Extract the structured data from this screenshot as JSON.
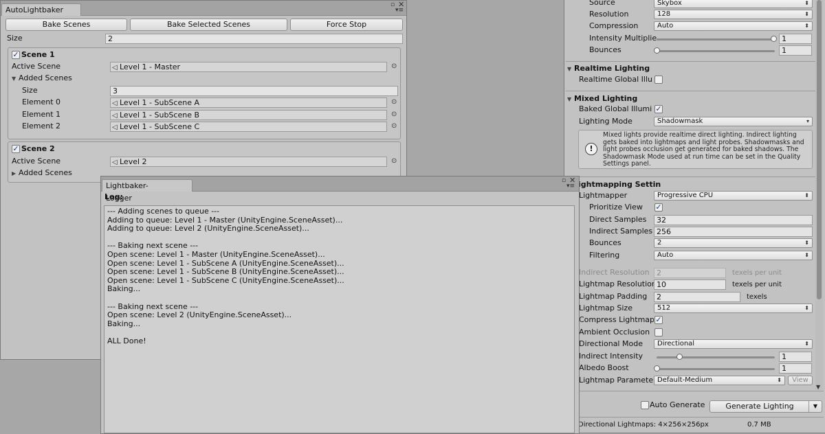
{
  "autolightbaker": {
    "tab_title": "AutoLightbaker",
    "buttons": {
      "bake_scenes": "Bake Scenes",
      "bake_selected": "Bake Selected Scenes",
      "force_stop": "Force Stop"
    },
    "size_label": "Size",
    "size_value": "2",
    "scene1": {
      "title": "Scene 1",
      "active_label": "Active Scene",
      "active_value": "Level 1 - Master",
      "added_label": "Added Scenes",
      "size_label": "Size",
      "size_value": "3",
      "elements": [
        {
          "label": "Element 0",
          "value": "Level 1 - SubScene A"
        },
        {
          "label": "Element 1",
          "value": "Level 1 - SubScene B"
        },
        {
          "label": "Element 2",
          "value": "Level 1 - SubScene C"
        }
      ]
    },
    "scene2": {
      "title": "Scene 2",
      "active_label": "Active Scene",
      "active_value": "Level 2",
      "added_label": "Added Scenes"
    }
  },
  "logger": {
    "tab_title": "Lightbaker-Logger",
    "log_label": "Log:",
    "log_text": "--- Adding scenes to queue ---\nAdding to queue: Level 1 - Master (UnityEngine.SceneAsset)...\nAdding to queue: Level 2 (UnityEngine.SceneAsset)...\n\n--- Baking next scene ---\nOpen scene: Level 1 - Master (UnityEngine.SceneAsset)...\nOpen scene: Level 1 - SubScene A (UnityEngine.SceneAsset)...\nOpen scene: Level 1 - SubScene B (UnityEngine.SceneAsset)...\nOpen scene: Level 1 - SubScene C (UnityEngine.SceneAsset)...\nBaking...\n\n--- Baking next scene ---\nOpen scene: Level 2 (UnityEngine.SceneAsset)...\nBaking...\n\nALL Done!"
  },
  "lighting": {
    "env": {
      "source_label": "Source",
      "source_value": "Skybox",
      "resolution_label": "Resolution",
      "resolution_value": "128",
      "compression_label": "Compression",
      "compression_value": "Auto",
      "intensity_label": "Intensity Multiplie",
      "intensity_value": "1",
      "intensity_fraction": 1.0,
      "bounces_label": "Bounces",
      "bounces_value": "1",
      "bounces_fraction": 0.0
    },
    "realtime": {
      "title": "Realtime Lighting",
      "gi_label": "Realtime Global Illu",
      "gi_checked": false
    },
    "mixed": {
      "title": "Mixed Lighting",
      "baked_gi_label": "Baked Global Illumi",
      "baked_gi_checked": true,
      "mode_label": "Lighting Mode",
      "mode_value": "Shadowmask",
      "help_lines": [
        "Mixed lights provide realtime direct lighting. Indirect lighting",
        "gets baked into lightmaps and light probes. Shadowmasks and",
        "light probes occlusion get generated for baked shadows. The",
        "Shadowmask Mode used at run time can be set in the Quality",
        "Settings panel."
      ]
    },
    "lightmapping": {
      "title": "ightmapping Settin",
      "lightmapper_label": "Lightmapper",
      "lightmapper_value": "Progressive CPU",
      "prioritize_label": "Prioritize View",
      "prioritize_checked": true,
      "direct_label": "Direct Samples",
      "direct_value": "32",
      "indirect_label": "Indirect Samples",
      "indirect_value": "256",
      "bounces_label": "Bounces",
      "bounces_value": "2",
      "filtering_label": "Filtering",
      "filtering_value": "Auto",
      "ind_res_label": "Indirect Resolution",
      "ind_res_value": "2",
      "ind_res_unit": "texels per unit",
      "lm_res_label": "Lightmap Resolutior",
      "lm_res_value": "10",
      "lm_res_unit": "texels per unit",
      "padding_label": "Lightmap Padding",
      "padding_value": "2",
      "padding_unit": "texels",
      "size_label": "Lightmap Size",
      "size_value": "512",
      "compress_label": "Compress Lightmap",
      "compress_checked": true,
      "ao_label": "Ambient Occlusion",
      "ao_checked": false,
      "dir_mode_label": "Directional Mode",
      "dir_mode_value": "Directional",
      "ind_int_label": "Indirect Intensity",
      "ind_int_value": "1",
      "ind_int_fraction": 0.2,
      "albedo_label": "Albedo Boost",
      "albedo_value": "1",
      "albedo_fraction": 0.0,
      "params_label": "Lightmap Paramete",
      "params_value": "Default-Medium",
      "view_label": "View"
    },
    "auto_generate_label": "Auto Generate",
    "auto_generate_checked": false,
    "generate_label": "Generate Lighting",
    "status_left": "Directional Lightmaps: 4×256×256px",
    "status_right": "0.7 MB"
  }
}
